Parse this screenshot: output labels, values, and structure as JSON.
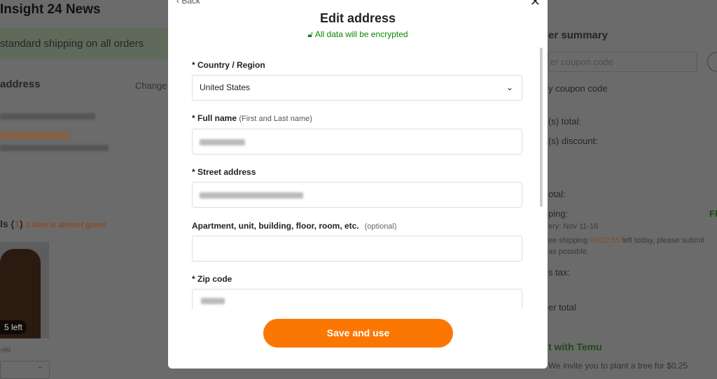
{
  "watermark": "Insight 24 News",
  "background": {
    "banner": "standard shipping on all orders",
    "address_heading": "address",
    "change_link": "Change",
    "items_heading": "ls (",
    "items_count": "1",
    "items_heading_close": ")",
    "almost_gone": "1 item is almost gone!",
    "stock_badge": "5 left",
    "price": ".99",
    "summary_title": "er summary",
    "coupon_placeholder": "er coupon code",
    "apply_coupon": "y coupon code",
    "items_total": "(s) total:",
    "items_discount": "(s) discount:",
    "subtotal": "otal:",
    "shipping": "ping:",
    "shipping_value": "FR",
    "delivery": "ery: Nov 11-16",
    "free_shipping_pre": "ee shipping ",
    "countdown": "04:22:55",
    "free_shipping_post": " left today, please submit",
    "free_shipping_line2": "as possible.",
    "tax": "s tax:",
    "order_total": "er total",
    "temu_heading": "t with Temu",
    "tree_text": "We invite you to plant a tree for $0.25"
  },
  "modal": {
    "back": "Back",
    "title": "Edit address",
    "encrypted": "All data will be encrypted",
    "country_label": "Country / Region",
    "country_value": "United States",
    "fullname_label": "Full name",
    "fullname_sub": "(First and Last name)",
    "street_label": "Street address",
    "apt_label": "Apartment, unit, building, floor, room, etc.",
    "apt_optional": "(optional)",
    "zip_label": "Zip code",
    "save_button": "Save and use"
  },
  "colors": {
    "accent": "#fb7701",
    "green": "#0a8800"
  }
}
